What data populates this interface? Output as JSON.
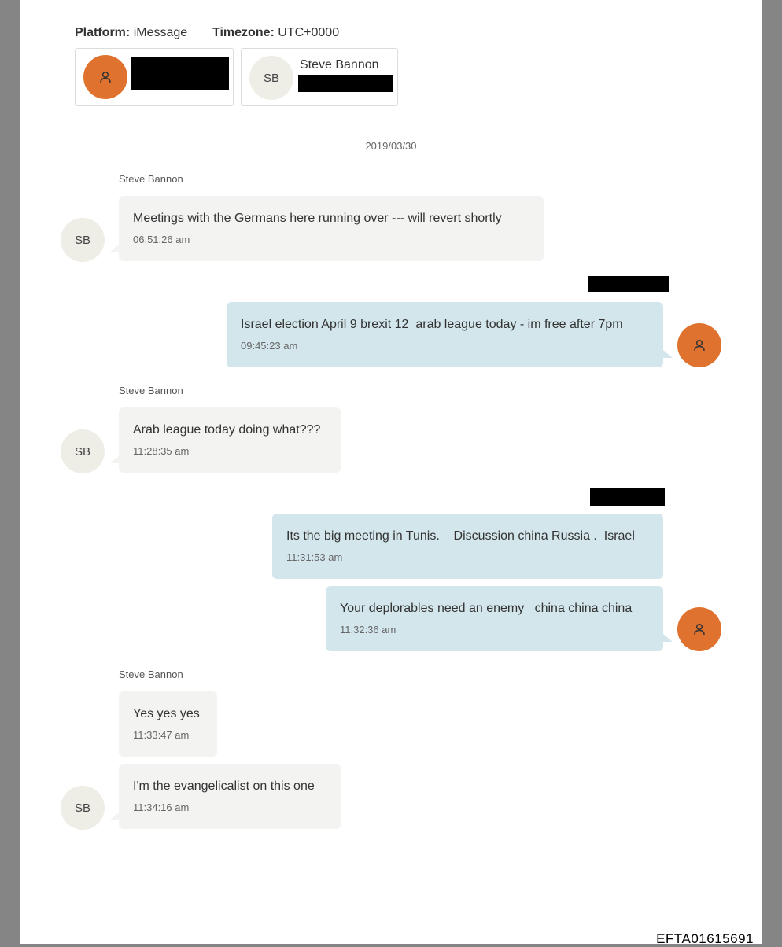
{
  "header": {
    "platform_label": "Platform:",
    "platform_value": "iMessage",
    "timezone_label": "Timezone:",
    "timezone_value": "UTC+0000"
  },
  "participants": [
    {
      "initials": "",
      "name": "",
      "redacted": true,
      "avatar_icon": "person-icon",
      "color": "#e0722f"
    },
    {
      "initials": "SB",
      "name": "Steve Bannon"
    }
  ],
  "date": "2019/03/30",
  "messages": [
    {
      "sender": "Steve Bannon",
      "text": "Meetings with the Germans here running over --- will revert shortly",
      "time": "06:51:26 am"
    },
    {
      "text": "Israel election April 9 brexit 12  arab league today - im free after 7pm",
      "time": "09:45:23 am"
    },
    {
      "sender": "Steve Bannon",
      "text": "Arab league today doing what???",
      "time": "11:28:35 am"
    },
    {
      "text": "Its the big meeting in Tunis.    Discussion china Russia .  Israel",
      "time": "11:31:53 am"
    },
    {
      "text": "Your deplorables need an enemy   china china china",
      "time": "11:32:36 am"
    },
    {
      "sender": "Steve Bannon",
      "text": "Yes yes yes",
      "time": "11:33:47 am"
    },
    {
      "text": "I'm the evangelicalist on this one",
      "time": "11:34:16 am"
    }
  ],
  "avatar_initials": "SB",
  "footer_code": "EFTA01615691",
  "colors": {
    "outgoing_bubble": "#d3e6ec",
    "incoming_bubble": "#f3f3f2",
    "user_avatar": "#e0722f"
  }
}
